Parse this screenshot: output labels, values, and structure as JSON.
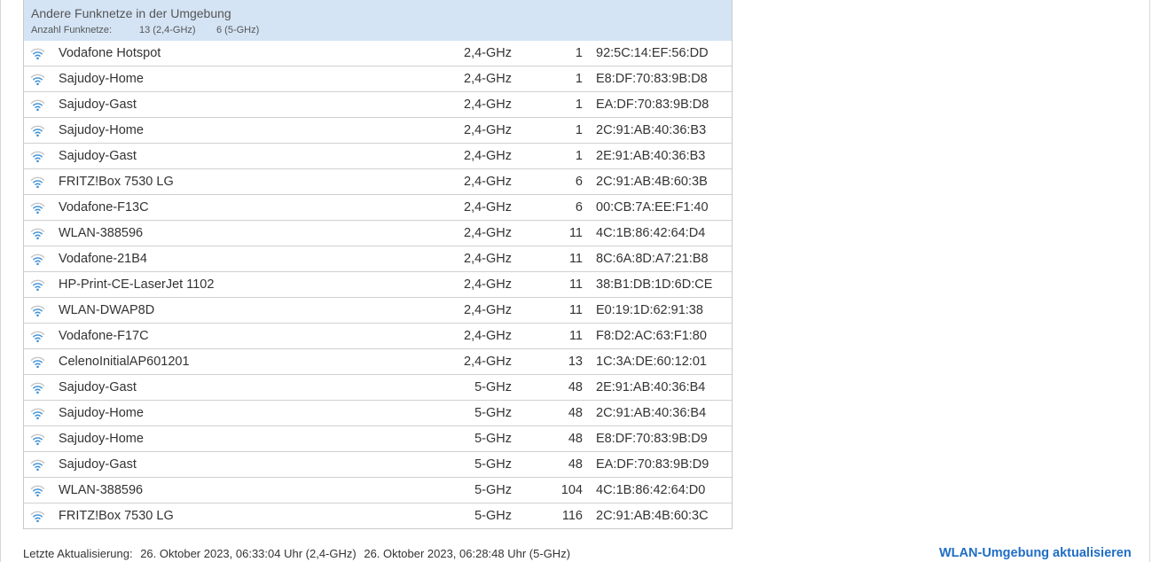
{
  "header": {
    "title": "Andere Funknetze in der Umgebung",
    "count_label": "Anzahl Funknetze:",
    "count_24": "13 (2,4-GHz)",
    "count_5": "6 (5-GHz)"
  },
  "networks": [
    {
      "ssid": "Vodafone Hotspot",
      "band": "2,4-GHz",
      "channel": "1",
      "mac": "92:5C:14:EF:56:DD"
    },
    {
      "ssid": "Sajudoy-Home",
      "band": "2,4-GHz",
      "channel": "1",
      "mac": "E8:DF:70:83:9B:D8"
    },
    {
      "ssid": "Sajudoy-Gast",
      "band": "2,4-GHz",
      "channel": "1",
      "mac": "EA:DF:70:83:9B:D8"
    },
    {
      "ssid": "Sajudoy-Home",
      "band": "2,4-GHz",
      "channel": "1",
      "mac": "2C:91:AB:40:36:B3"
    },
    {
      "ssid": "Sajudoy-Gast",
      "band": "2,4-GHz",
      "channel": "1",
      "mac": "2E:91:AB:40:36:B3"
    },
    {
      "ssid": "FRITZ!Box 7530 LG",
      "band": "2,4-GHz",
      "channel": "6",
      "mac": "2C:91:AB:4B:60:3B"
    },
    {
      "ssid": "Vodafone-F13C",
      "band": "2,4-GHz",
      "channel": "6",
      "mac": "00:CB:7A:EE:F1:40"
    },
    {
      "ssid": "WLAN-388596",
      "band": "2,4-GHz",
      "channel": "11",
      "mac": "4C:1B:86:42:64:D4"
    },
    {
      "ssid": "Vodafone-21B4",
      "band": "2,4-GHz",
      "channel": "11",
      "mac": "8C:6A:8D:A7:21:B8"
    },
    {
      "ssid": "HP-Print-CE-LaserJet 1102",
      "band": "2,4-GHz",
      "channel": "11",
      "mac": "38:B1:DB:1D:6D:CE"
    },
    {
      "ssid": "WLAN-DWAP8D",
      "band": "2,4-GHz",
      "channel": "11",
      "mac": "E0:19:1D:62:91:38"
    },
    {
      "ssid": "Vodafone-F17C",
      "band": "2,4-GHz",
      "channel": "11",
      "mac": "F8:D2:AC:63:F1:80"
    },
    {
      "ssid": "CelenoInitialAP601201",
      "band": "2,4-GHz",
      "channel": "13",
      "mac": "1C:3A:DE:60:12:01"
    },
    {
      "ssid": "Sajudoy-Gast",
      "band": "5-GHz",
      "channel": "48",
      "mac": "2E:91:AB:40:36:B4"
    },
    {
      "ssid": "Sajudoy-Home",
      "band": "5-GHz",
      "channel": "48",
      "mac": "2C:91:AB:40:36:B4"
    },
    {
      "ssid": "Sajudoy-Home",
      "band": "5-GHz",
      "channel": "48",
      "mac": "E8:DF:70:83:9B:D9"
    },
    {
      "ssid": "Sajudoy-Gast",
      "band": "5-GHz",
      "channel": "48",
      "mac": "EA:DF:70:83:9B:D9"
    },
    {
      "ssid": "WLAN-388596",
      "band": "5-GHz",
      "channel": "104",
      "mac": "4C:1B:86:42:64:D0"
    },
    {
      "ssid": "FRITZ!Box 7530 LG",
      "band": "5-GHz",
      "channel": "116",
      "mac": "2C:91:AB:4B:60:3C"
    }
  ],
  "footer": {
    "label": "Letzte Aktualisierung:",
    "update_24": "26. Oktober 2023, 06:33:04 Uhr (2,4-GHz)",
    "update_5": "26. Oktober 2023, 06:28:48 Uhr (5-GHz)"
  },
  "refresh_link": "WLAN-Umgebung aktualisieren",
  "colors": {
    "header_bg": "#d4e4f5",
    "link": "#1f6ec4",
    "wifi_icon": "#3a8fd6"
  }
}
